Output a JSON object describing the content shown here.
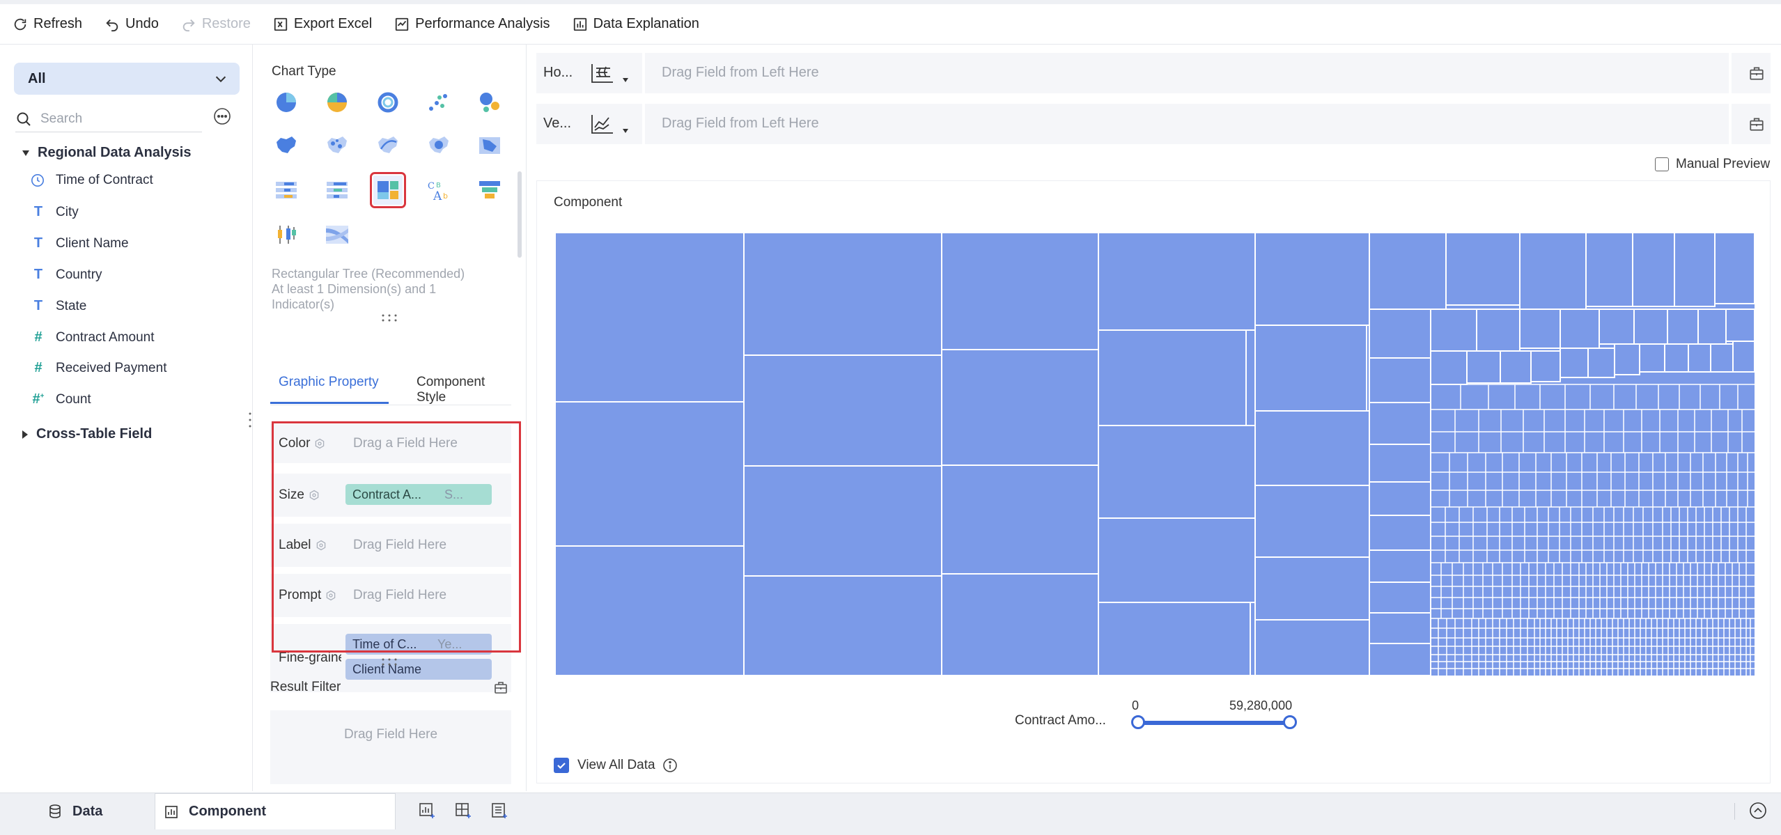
{
  "toolbar": {
    "refresh": "Refresh",
    "undo": "Undo",
    "restore": "Restore",
    "export_excel": "Export Excel",
    "performance_analysis": "Performance Analysis",
    "data_explanation": "Data Explanation"
  },
  "sidebar": {
    "dataset_select": "All",
    "search_placeholder": "Search",
    "group_title": "Regional Data Analysis",
    "fields": [
      {
        "label": "Time of Contract",
        "icon": "clock-icon"
      },
      {
        "label": "City",
        "icon": "text-type-icon"
      },
      {
        "label": "Client Name",
        "icon": "text-type-icon"
      },
      {
        "label": "Country",
        "icon": "text-type-icon"
      },
      {
        "label": "State",
        "icon": "text-type-icon"
      },
      {
        "label": "Contract Amount",
        "icon": "number-type-icon"
      },
      {
        "label": "Received Payment",
        "icon": "number-type-icon"
      },
      {
        "label": "Count",
        "icon": "calculated-number-icon"
      }
    ],
    "cross_table": "Cross-Table Field"
  },
  "chart_type": {
    "title": "Chart Type",
    "icons": [
      "pie-chart-icon",
      "multi-pie-icon",
      "donut-chart-icon",
      "scatter-icon",
      "bubble-icon",
      "region-map-icon",
      "point-map-icon",
      "flow-map-icon",
      "heat-map-icon",
      "area-map-icon",
      "bar-table-icon",
      "list-bar-icon",
      "treemap-icon",
      "word-cloud-icon",
      "funnel-icon",
      "candlestick-icon",
      "sankey-icon"
    ],
    "selected": "treemap-icon",
    "description": "Rectangular Tree (Recommended) At least 1 Dimension(s) and 1 Indicator(s)"
  },
  "property_tabs": {
    "graphic": "Graphic Property",
    "style": "Component Style"
  },
  "properties": {
    "color_label": "Color",
    "color_placeholder": "Drag a Field Here",
    "size_label": "Size",
    "size_pill": "Contract A...",
    "size_pill_sub": "S...",
    "label_label": "Label",
    "label_placeholder": "Drag Field Here",
    "prompt_label": "Prompt",
    "prompt_placeholder": "Drag Field Here",
    "fine_label": "Fine-grained",
    "fine_pill1": "Time of C...",
    "fine_pill1_sub": "Ye...",
    "fine_pill2": "Client Name"
  },
  "result_filter": {
    "title": "Result Filter",
    "placeholder": "Drag Field Here"
  },
  "axes": {
    "horizontal_label": "Ho...",
    "vertical_label": "Ve...",
    "placeholder": "Drag Field from Left Here"
  },
  "manual_preview": "Manual Preview",
  "component": {
    "title": "Component",
    "slider_label": "Contract Amo...",
    "slider_min": "0",
    "slider_max": "59,280,000",
    "view_all": "View All Data"
  },
  "bottom_tabs": {
    "data": "Data",
    "component": "Component"
  },
  "colors": {
    "accent": "#3a68d6",
    "treemap_fill": "#7b9ae8",
    "highlight": "#d9363e"
  }
}
